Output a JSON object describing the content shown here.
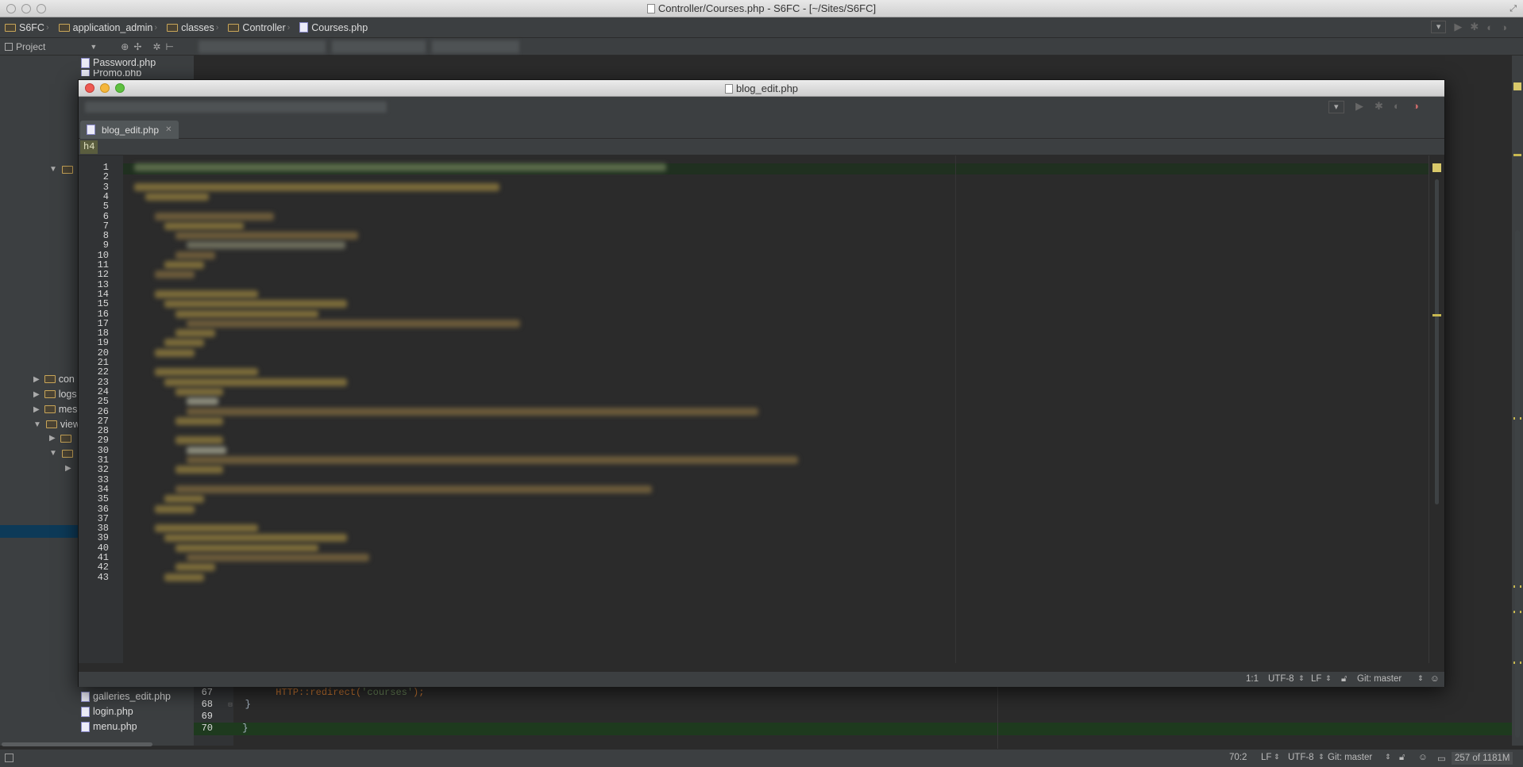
{
  "window": {
    "title": "Controller/Courses.php - S6FC - [~/Sites/S6FC]"
  },
  "breadcrumbs": [
    {
      "label": "S6FC",
      "kind": "folder"
    },
    {
      "label": "application_admin",
      "kind": "folder"
    },
    {
      "label": "classes",
      "kind": "folder"
    },
    {
      "label": "Controller",
      "kind": "folder"
    },
    {
      "label": "Courses.php",
      "kind": "php"
    }
  ],
  "project_panel": {
    "title": "Project"
  },
  "tree": {
    "top_files": [
      "Password.php",
      "Promo.php"
    ],
    "folders": [
      "con",
      "logs",
      "mes",
      "view"
    ],
    "bottom_files": [
      "galleries_edit.php",
      "login.php",
      "menu.php"
    ]
  },
  "bg_editor": {
    "lines": [
      {
        "num": "67",
        "code_fn": "HTTP::redirect(",
        "code_str": "'courses'",
        "code_end": ");"
      },
      {
        "num": "68",
        "code_end": "}"
      },
      {
        "num": "69",
        "code_end": ""
      },
      {
        "num": "70",
        "code_end": "}"
      }
    ]
  },
  "statusbar": {
    "position": "70:2",
    "line_sep": "LF",
    "encoding": "UTF-8",
    "vcs": "Git: master",
    "memory": "257 of 1181M"
  },
  "float_window": {
    "title": "blog_edit.php",
    "tab_label": "blog_edit.php",
    "breadcrumb_tag": "h4",
    "line_numbers": [
      "1",
      "2",
      "3",
      "4",
      "5",
      "6",
      "7",
      "8",
      "9",
      "10",
      "11",
      "12",
      "13",
      "14",
      "15",
      "16",
      "17",
      "18",
      "19",
      "20",
      "21",
      "22",
      "23",
      "24",
      "25",
      "26",
      "27",
      "28",
      "29",
      "30",
      "31",
      "32",
      "33",
      "34",
      "35",
      "36",
      "37",
      "38",
      "39",
      "40",
      "41",
      "42",
      "43"
    ],
    "status": {
      "position": "1:1",
      "encoding": "UTF-8",
      "line_sep": "LF",
      "vcs": "Git: master"
    }
  }
}
